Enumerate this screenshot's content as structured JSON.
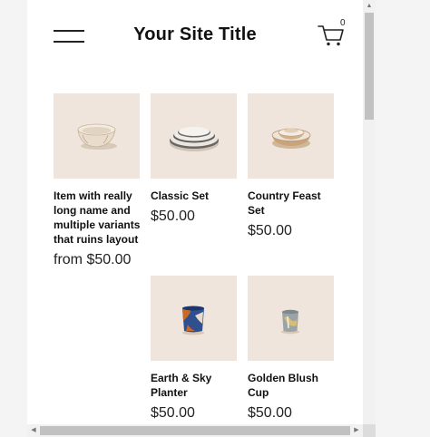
{
  "header": {
    "site_title": "Your Site Title",
    "cart_count": "0",
    "menu_icon": "hamburger-menu-icon",
    "cart_icon": "shopping-cart-icon"
  },
  "products": [
    {
      "name": "Item with really long name and multiple variants that ruins layout",
      "price": "from $50.00",
      "image": "cream-bowl"
    },
    {
      "name": "Classic Set",
      "price": "$50.00",
      "image": "stacked-plates"
    },
    {
      "name": "Country Feast Set",
      "price": "$50.00",
      "image": "stacked-bowls"
    },
    {
      "name": "Earth & Sky Planter",
      "price": "$50.00",
      "image": "blue-orange-planter"
    },
    {
      "name": "Golden Blush Cup",
      "price": "$50.00",
      "image": "gray-cup"
    }
  ],
  "colors": {
    "thumb_background": "#efe5dc",
    "page_background": "#ffffff",
    "text": "#111111"
  },
  "scrollbars": {
    "vertical": "visible",
    "horizontal": "visible"
  }
}
